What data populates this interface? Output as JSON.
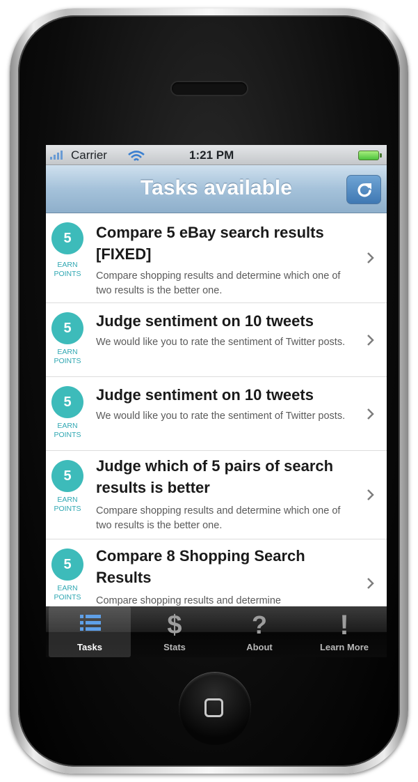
{
  "status_bar": {
    "carrier": "Carrier",
    "time": "1:21 PM"
  },
  "nav_bar": {
    "title": "Tasks available",
    "refresh_icon": "refresh-icon"
  },
  "colors": {
    "accent_teal": "#3dbbba",
    "nav_blue": "#a5c2da",
    "tab_bar": "#1c1c1c"
  },
  "tasks": [
    {
      "points": "5",
      "earn_line1": "EARN",
      "earn_line2": "POINTS",
      "title": "Compare 5 eBay search results [FIXED]",
      "description": "Compare shopping results and determine which one of two results is the better one."
    },
    {
      "points": "5",
      "earn_line1": "EARN",
      "earn_line2": "POINTS",
      "title": "Judge sentiment on 10 tweets",
      "description": "We would like you to rate the sentiment of Twitter posts."
    },
    {
      "points": "5",
      "earn_line1": "EARN",
      "earn_line2": "POINTS",
      "title": "Judge sentiment on 10 tweets",
      "description": "We would like you to rate the sentiment of Twitter posts."
    },
    {
      "points": "5",
      "earn_line1": "EARN",
      "earn_line2": "POINTS",
      "title": "Judge which of 5 pairs of search results is better",
      "description": "Compare shopping results and determine which one of two results is the better one."
    },
    {
      "points": "5",
      "earn_line1": "EARN",
      "earn_line2": "POINTS",
      "title": "Compare 8 Shopping Search Results",
      "description": "Compare shopping results and determine"
    }
  ],
  "tab_bar": {
    "selected": "Tasks",
    "tabs": [
      {
        "label": "Tasks",
        "icon": "list-icon"
      },
      {
        "label": "Stats",
        "icon": "dollar-icon"
      },
      {
        "label": "About",
        "icon": "question-icon"
      },
      {
        "label": "Learn More",
        "icon": "exclamation-icon"
      }
    ]
  }
}
